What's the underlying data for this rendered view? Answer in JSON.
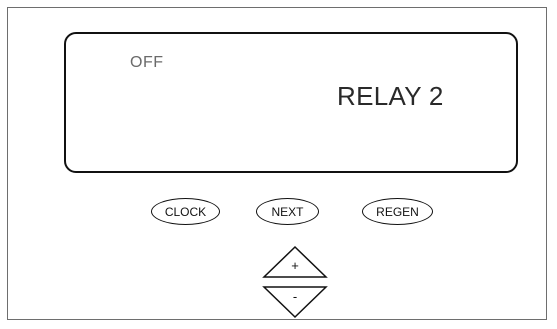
{
  "display": {
    "status": "OFF",
    "message": "RELAY 2"
  },
  "buttons": {
    "clock": "CLOCK",
    "next": "NEXT",
    "regen": "REGEN"
  },
  "adjust": {
    "up_label": "+",
    "down_label": "-"
  },
  "colors": {
    "frame_border": "#6e6e6e",
    "outline": "#111111",
    "status_text": "#6a6a6a",
    "message_text": "#2a2a2a",
    "background": "#ffffff"
  }
}
